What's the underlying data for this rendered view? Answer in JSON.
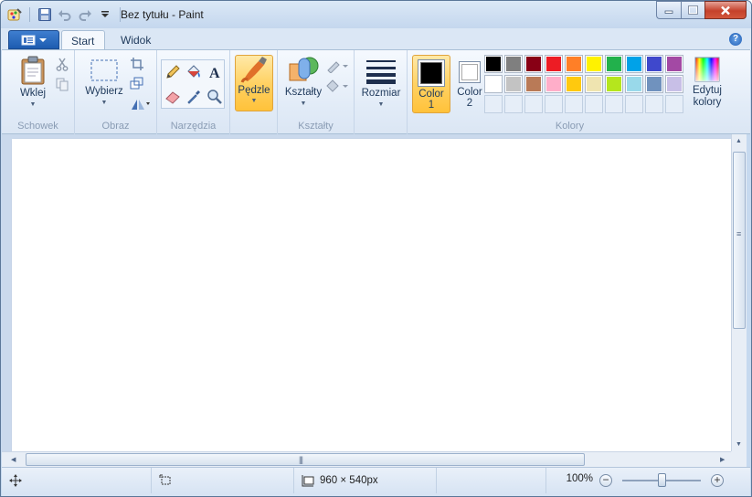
{
  "window": {
    "title": "Bez tytułu - Paint"
  },
  "quick_access": {
    "icons": [
      "paint-app-icon",
      "save-icon",
      "undo-icon",
      "redo-icon",
      "customize-dropdown-icon"
    ]
  },
  "tabs": [
    {
      "label": "Start",
      "active": true
    },
    {
      "label": "Widok",
      "active": false
    }
  ],
  "ribbon": {
    "clipboard": {
      "group_label": "Schowek",
      "paste_label": "Wklej"
    },
    "image": {
      "group_label": "Obraz",
      "select_label": "Wybierz"
    },
    "tools": {
      "group_label": "Narzędzia"
    },
    "brushes": {
      "label": "Pędzle"
    },
    "shapes": {
      "group_label": "Kształty",
      "shapes_label": "Kształty"
    },
    "size": {
      "label": "Rozmiar"
    },
    "colors": {
      "group_label": "Kolory",
      "color1_label": "Color",
      "color1_num": "1",
      "color2_label": "Color",
      "color2_num": "2",
      "color1_value": "#000000",
      "color2_value": "#ffffff",
      "edit_label_1": "Edytuj",
      "edit_label_2": "kolory",
      "palette_row1": [
        "#000000",
        "#7f7f7f",
        "#880015",
        "#ed1c24",
        "#ff7f27",
        "#fff200",
        "#22b14c",
        "#00a2e8",
        "#3f48cc",
        "#a349a4"
      ],
      "palette_row2": [
        "#ffffff",
        "#c3c3c3",
        "#b97a57",
        "#ffaec9",
        "#ffc90e",
        "#efe4b0",
        "#b5e61d",
        "#99d9ea",
        "#7092be",
        "#c8bfe7"
      ]
    }
  },
  "statusbar": {
    "image_size": "960 × 540px",
    "zoom": "100%"
  }
}
